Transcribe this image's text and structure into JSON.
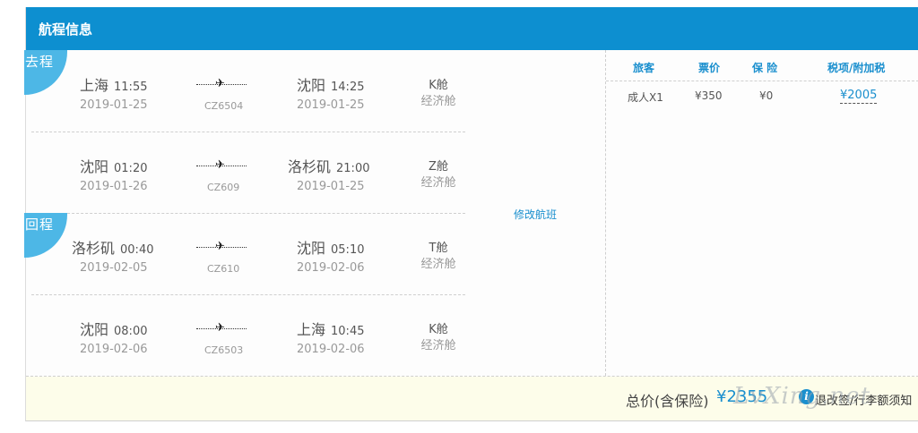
{
  "header": {
    "title": "航程信息"
  },
  "outbound_label": "去程",
  "return_label": "回程",
  "plane_glyph": "✈",
  "flights": [
    {
      "from_city": "上海",
      "dep_time": "11:55",
      "dep_date": "2019-01-25",
      "flight_no": "CZ6504",
      "to_city": "沈阳",
      "arr_time": "14:25",
      "arr_date": "2019-01-25",
      "cabin": "K舱",
      "cabin_type": "经济舱"
    },
    {
      "from_city": "沈阳",
      "dep_time": "01:20",
      "dep_date": "2019-01-26",
      "flight_no": "CZ609",
      "to_city": "洛杉矶",
      "arr_time": "21:00",
      "arr_date": "2019-01-25",
      "cabin": "Z舱",
      "cabin_type": "经济舱"
    },
    {
      "from_city": "洛杉矶",
      "dep_time": "00:40",
      "dep_date": "2019-02-05",
      "flight_no": "CZ610",
      "to_city": "沈阳",
      "arr_time": "05:10",
      "arr_date": "2019-02-06",
      "cabin": "T舱",
      "cabin_type": "经济舱"
    },
    {
      "from_city": "沈阳",
      "dep_time": "08:00",
      "dep_date": "2019-02-06",
      "flight_no": "CZ6503",
      "to_city": "上海",
      "arr_time": "10:45",
      "arr_date": "2019-02-06",
      "cabin": "K舱",
      "cabin_type": "经济舱"
    }
  ],
  "modify_link": "修改航班",
  "price_table": {
    "headers": {
      "passenger": "旅客",
      "fare": "票价",
      "insurance": "保 险",
      "tax": "税项/附加税"
    },
    "row": {
      "passenger": "成人X1",
      "fare": "¥350",
      "insurance": "¥0",
      "tax": "¥2005"
    }
  },
  "footer": {
    "total_label": "总价(含保险)",
    "total_value": "¥2355",
    "rule_link": "退改签/行李额须知",
    "watermark": "LvXing.net"
  },
  "colors": {
    "header_bg": "#0d8fd0",
    "accent": "#1a8fce",
    "badge": "#4db7e6",
    "footer_bg": "#fdfdea"
  }
}
